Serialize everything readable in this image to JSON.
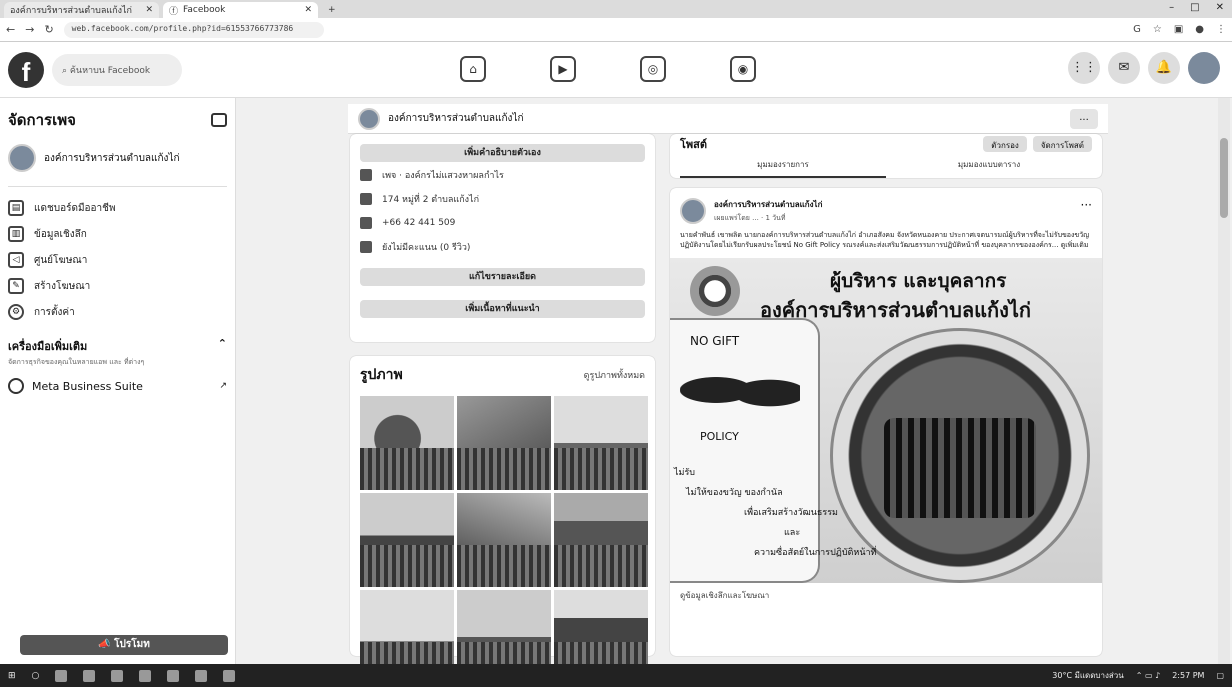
{
  "browser": {
    "tabs": [
      {
        "title": "องค์การบริหารส่วนตำบลแก้งไก่",
        "active": false
      },
      {
        "title": "Facebook",
        "active": true
      }
    ],
    "url": "web.facebook.com/profile.php?id=61553766773786",
    "window_controls": [
      "–",
      "□",
      "✕"
    ]
  },
  "fb": {
    "search_placeholder": "ค้นหาบน Facebook",
    "nav_icons": [
      "home-icon",
      "video-icon",
      "marketplace-icon",
      "gaming-icon"
    ]
  },
  "sidebar": {
    "title": "จัดการเพจ",
    "page_name": "องค์การบริหารส่วนตำบลแก้งไก่",
    "items": [
      {
        "label": "แดชบอร์ดมืออาชีพ",
        "icon": "dashboard-icon"
      },
      {
        "label": "ข้อมูลเชิงลึก",
        "icon": "insights-icon"
      },
      {
        "label": "ศูนย์โฆษณา",
        "icon": "ad-center-icon"
      },
      {
        "label": "สร้างโฆษณา",
        "icon": "create-ad-icon"
      },
      {
        "label": "การตั้งค่า",
        "icon": "gear-icon"
      }
    ],
    "tools_title": "เครื่องมือเพิ่มเติม",
    "tools_sub": "จัดการธุรกิจของคุณในหลายแอพ และ ที่ต่างๆ",
    "meta_label": "Meta Business Suite",
    "promote_label": "โปรโมท"
  },
  "pagestrip": {
    "name": "องค์การบริหารส่วนตำบลแก้งไก่",
    "more": "..."
  },
  "intro": {
    "add_bio": "เพิ่มคำอธิบายตัวเอง",
    "rows": [
      "เพจ · องค์กรไม่แสวงหาผลกำไร",
      "174 หมู่ที่ 2 ตำบลแก้งไก่",
      "+66 42 441 509",
      "ยังไม่มีคะแนน (0 รีวิว)"
    ],
    "edit_details": "แก้ไขรายละเอียด",
    "add_featured": "เพิ่มเนื้อหาที่แนะนำ"
  },
  "photos": {
    "title": "รูปภาพ",
    "see_all": "ดูรูปภาพทั้งหมด"
  },
  "toolbar": {
    "label": "โพสต์",
    "filters": "ตัวกรอง",
    "manage": "จัดการโพสต์",
    "tab_list": "มุมมองรายการ",
    "tab_grid": "มุมมองแบบตาราง"
  },
  "post": {
    "author": "องค์การบริหารส่วนตำบลแก้งไก่",
    "meta": "เผยแพร่โดย ... · 1 วันที่",
    "text": "นายคำพันธ์ เขาพลิด นายกองค์การบริหารส่วนตำบลแก้งไก่ อำเภอสังคม จังหวัดหนองคาย ประกาศเจตนารมณ์ผู้บริหารที่จะไม่รับของขวัญ ปฏิบัติงานโดยไม่เรียกรับผลประโยชน์ No Gift Policy รณรงค์และส่งเสริมวัฒนธรรมการปฏิบัติหน้าที่ ของบุคลากรขององค์กร... ดูเพิ่มเติม",
    "img_title1": "ผู้บริหาร และบุคลากร",
    "img_title2": "องค์การบริหารส่วนตำบลแก้งไก่",
    "img_nogift": "NO GIFT",
    "img_policy": "POLICY",
    "img_lines": [
      "ไม่รับ",
      "ไม่ให้ของขวัญ ของกำนัล",
      "เพื่อเสริมสร้างวัฒนธรรม",
      "และ",
      "ความซื่อสัตย์ในการปฏิบัติหน้าที่"
    ],
    "footer": "ดูข้อมูลเชิงลึกและโฆษณา"
  },
  "taskbar": {
    "weather": "30°C มีแดดบางส่วน",
    "time": "2:57 PM"
  }
}
